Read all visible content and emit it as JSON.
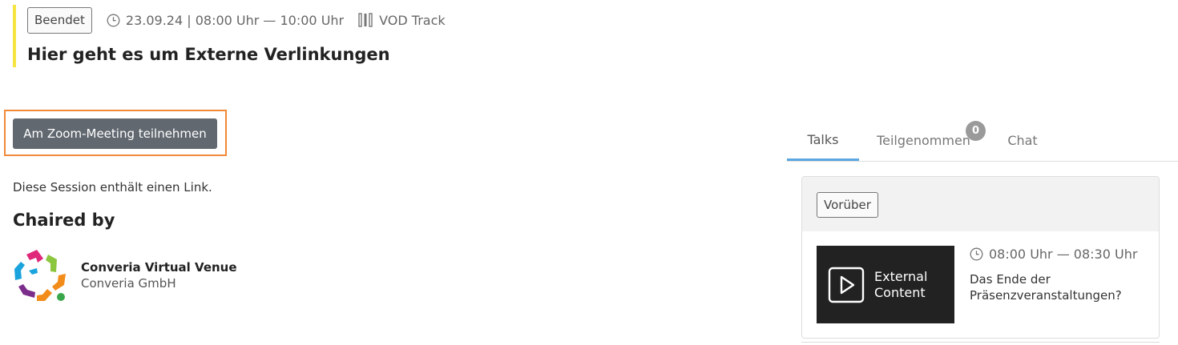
{
  "session": {
    "status": "Beendet",
    "datetime": "23.09.24 | 08:00 Uhr — 10:00 Uhr",
    "track": "VOD Track",
    "title": "Hier geht es um Externe Verlinkungen",
    "accent_color": "#f5e340"
  },
  "actions": {
    "join_label": "Am Zoom-Meeting teilnehmen"
  },
  "notes": {
    "link_info": "Diese Session enthält einen Link."
  },
  "chair": {
    "heading": "Chaired by",
    "name": "Converia Virtual Venue",
    "organization": "Converia GmbH",
    "logo": "converia-logo"
  },
  "tabs": [
    {
      "label": "Talks",
      "active": true
    },
    {
      "label": "Teilgenommen",
      "count": "0"
    },
    {
      "label": "Chat"
    }
  ],
  "talks": {
    "group_status": "Vorüber",
    "items": [
      {
        "thumbnail_line1": "External",
        "thumbnail_line2": "Content",
        "time": "08:00 Uhr — 08:30 Uhr",
        "title": "Das Ende der Präsenzveranstaltungen?"
      }
    ]
  },
  "colors": {
    "button": "#616870",
    "highlight": "#f0893a",
    "tab_active": "#5aa6e0"
  }
}
